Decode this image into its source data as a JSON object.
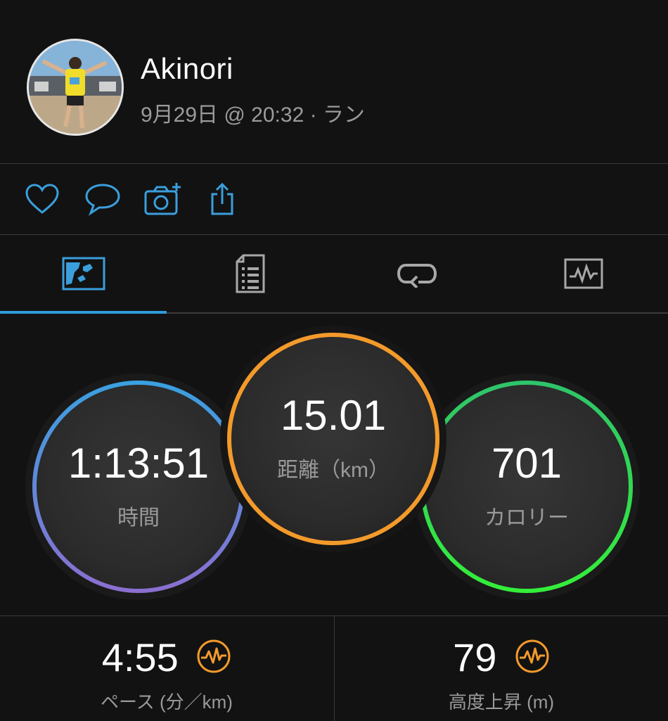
{
  "activity": {
    "user_name": "Akinori",
    "meta": "9月29日 @ 20:32 · ラン"
  },
  "actions": {
    "like_icon": "heart-icon",
    "comment_icon": "comment-icon",
    "photo_icon": "camera-plus-icon",
    "share_icon": "share-icon",
    "accent_color": "#3a9fdc"
  },
  "tabs": [
    {
      "icon": "map-icon",
      "active": true
    },
    {
      "icon": "details-icon",
      "active": false
    },
    {
      "icon": "laps-icon",
      "active": false
    },
    {
      "icon": "chart-icon",
      "active": false
    }
  ],
  "rings": {
    "time": {
      "value": "1:13:51",
      "label": "時間",
      "colors": [
        "#3aa0e0",
        "#8a6fd0"
      ]
    },
    "distance": {
      "value": "15.01",
      "label": "距離（km）",
      "color": "#f39a2b"
    },
    "calories": {
      "value": "701",
      "label": "カロリー",
      "colors": [
        "#2fc46a",
        "#34ee3a"
      ]
    }
  },
  "stats": {
    "pace": {
      "value": "4:55",
      "label": "ペース (分／km)",
      "icon": "pulse-icon"
    },
    "elevation": {
      "value": "79",
      "label": "高度上昇 (m)",
      "icon": "pulse-icon"
    },
    "icon_color": "#f39a2b"
  }
}
